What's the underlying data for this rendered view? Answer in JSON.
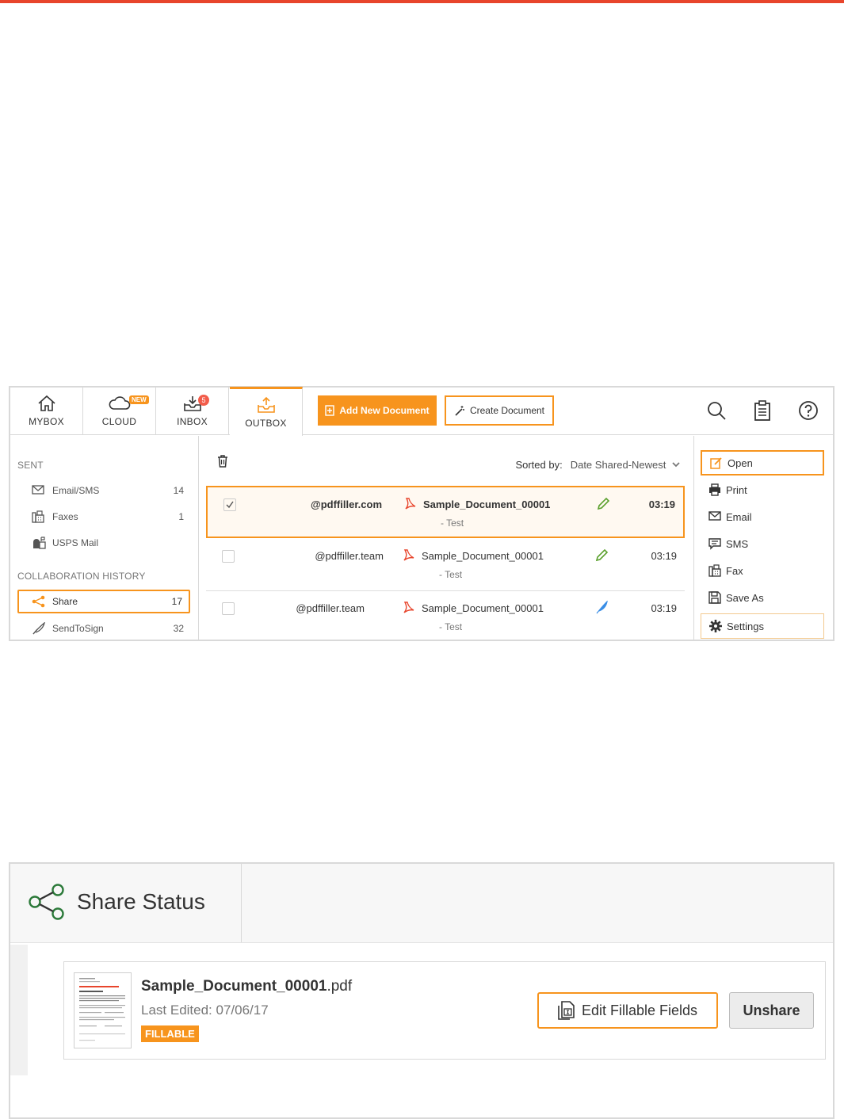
{
  "colors": {
    "accent": "#f7941d",
    "topbar": "#e8452c",
    "badge": "#f25c4a",
    "pen_green": "#5aa02c",
    "pen_blue": "#3a8ee6"
  },
  "tabs": [
    {
      "label": "MYBOX",
      "icon": "home-icon"
    },
    {
      "label": "CLOUD",
      "icon": "cloud-icon",
      "badge": "NEW"
    },
    {
      "label": "INBOX",
      "icon": "inbox-icon",
      "badge": "5"
    },
    {
      "label": "OUTBOX",
      "icon": "outbox-icon",
      "active": true
    }
  ],
  "toolbar": {
    "add_new_label": "Add New Document",
    "create_label": "Create Document",
    "icons": [
      "search-icon",
      "clipboard-icon",
      "help-icon"
    ]
  },
  "sidebar": {
    "sent_title": "SENT",
    "sent_items": [
      {
        "label": "Email/SMS",
        "count": "14",
        "icon": "envelope-icon"
      },
      {
        "label": "Faxes",
        "count": "1",
        "icon": "fax-icon"
      },
      {
        "label": "USPS Mail",
        "count": "",
        "icon": "mailbox-icon"
      }
    ],
    "collab_title": "COLLABORATION HISTORY",
    "collab_items": [
      {
        "label": "Share",
        "count": "17",
        "icon": "share-icon",
        "active": true
      },
      {
        "label": "SendToSign",
        "count": "32",
        "icon": "quill-icon"
      }
    ]
  },
  "list": {
    "sorted_label": "Sorted by:",
    "sorted_value": "Date Shared-Newest",
    "rows": [
      {
        "email": "@pdffiller.com",
        "doc": "Sample_Document_00001",
        "sub": "- Test",
        "time": "03:19",
        "checked": true
      },
      {
        "email": "@pdffiller.team",
        "doc": "Sample_Document_00001",
        "sub": "- Test",
        "time": "03:19",
        "checked": false
      },
      {
        "email": "@pdffiller.team",
        "doc": "Sample_Document_00001",
        "sub": "- Test",
        "time": "03:19",
        "checked": false
      }
    ]
  },
  "actions": [
    {
      "label": "Open",
      "icon": "edit-icon"
    },
    {
      "label": "Print",
      "icon": "printer-icon"
    },
    {
      "label": "Email",
      "icon": "envelope-icon"
    },
    {
      "label": "SMS",
      "icon": "message-icon"
    },
    {
      "label": "Fax",
      "icon": "fax-icon"
    },
    {
      "label": "Save As",
      "icon": "save-icon"
    },
    {
      "label": "Settings",
      "icon": "gear-icon"
    }
  ],
  "share_status": {
    "title": "Share Status",
    "doc_name": "Sample_Document_00001",
    "doc_ext": ".pdf",
    "last_edited": "Last Edited: 07/06/17",
    "badge": "FILLABLE",
    "edit_button": "Edit Fillable Fields",
    "unshare_button": "Unshare"
  }
}
